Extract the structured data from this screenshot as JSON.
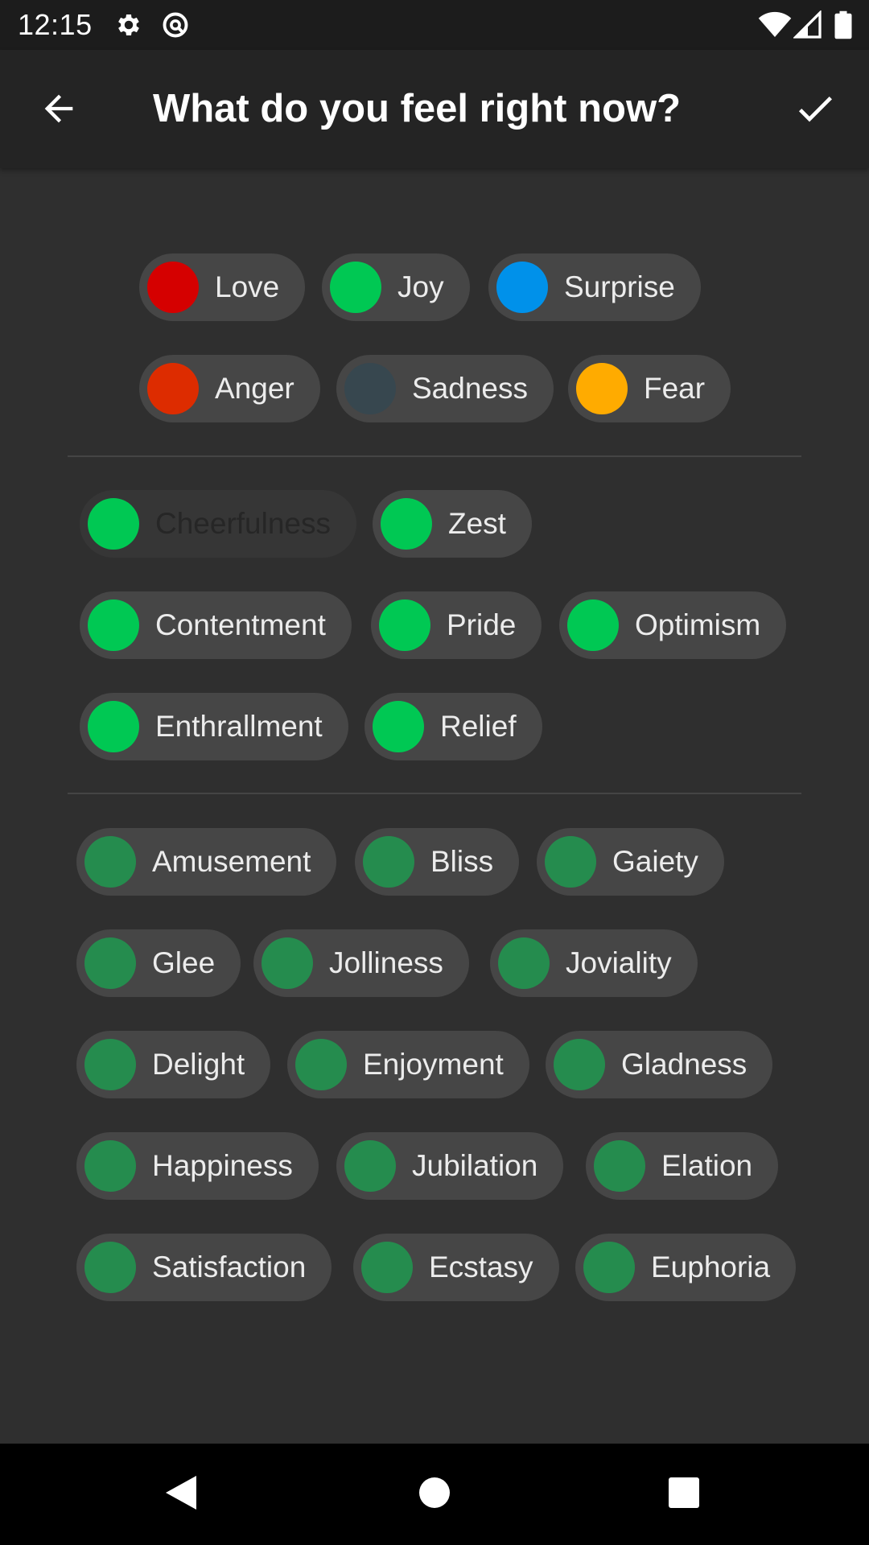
{
  "status_bar": {
    "time": "12:15",
    "icons_left": [
      "settings-icon",
      "vpn-key-icon"
    ],
    "icons_right": [
      "wifi-icon",
      "cell-signal-icon",
      "battery-icon"
    ]
  },
  "app_bar": {
    "title": "What do you feel right now?",
    "back_icon": "arrow-left-icon",
    "confirm_icon": "checkmark-icon"
  },
  "primary_emotions": [
    {
      "label": "Love",
      "color": "#d50000"
    },
    {
      "label": "Joy",
      "color": "#00c853"
    },
    {
      "label": "Surprise",
      "color": "#0091ea"
    },
    {
      "label": "Anger",
      "color": "#dd2c00"
    },
    {
      "label": "Sadness",
      "color": "#37474f"
    },
    {
      "label": "Fear",
      "color": "#ffab00"
    }
  ],
  "secondary_emotions": [
    {
      "label": "Cheerfulness",
      "color": "#00c853",
      "state": "selected-dim"
    },
    {
      "label": "Zest",
      "color": "#00c853"
    },
    {
      "label": "Contentment",
      "color": "#00c853"
    },
    {
      "label": "Pride",
      "color": "#00c853"
    },
    {
      "label": "Optimism",
      "color": "#00c853"
    },
    {
      "label": "Enthrallment",
      "color": "#00c853"
    },
    {
      "label": "Relief",
      "color": "#00c853"
    }
  ],
  "tertiary_emotions": [
    {
      "label": "Amusement",
      "color": "#258c4e"
    },
    {
      "label": "Bliss",
      "color": "#258c4e"
    },
    {
      "label": "Gaiety",
      "color": "#258c4e"
    },
    {
      "label": "Glee",
      "color": "#258c4e"
    },
    {
      "label": "Jolliness",
      "color": "#258c4e"
    },
    {
      "label": "Joviality",
      "color": "#258c4e"
    },
    {
      "label": "Delight",
      "color": "#258c4e"
    },
    {
      "label": "Enjoyment",
      "color": "#258c4e"
    },
    {
      "label": "Gladness",
      "color": "#258c4e"
    },
    {
      "label": "Happiness",
      "color": "#258c4e"
    },
    {
      "label": "Jubilation",
      "color": "#258c4e"
    },
    {
      "label": "Elation",
      "color": "#258c4e"
    },
    {
      "label": "Satisfaction",
      "color": "#258c4e"
    },
    {
      "label": "Ecstasy",
      "color": "#258c4e"
    },
    {
      "label": "Euphoria",
      "color": "#258c4e"
    }
  ],
  "nav_bar": {
    "icons": [
      "nav-back-icon",
      "nav-home-icon",
      "nav-recents-icon"
    ]
  }
}
